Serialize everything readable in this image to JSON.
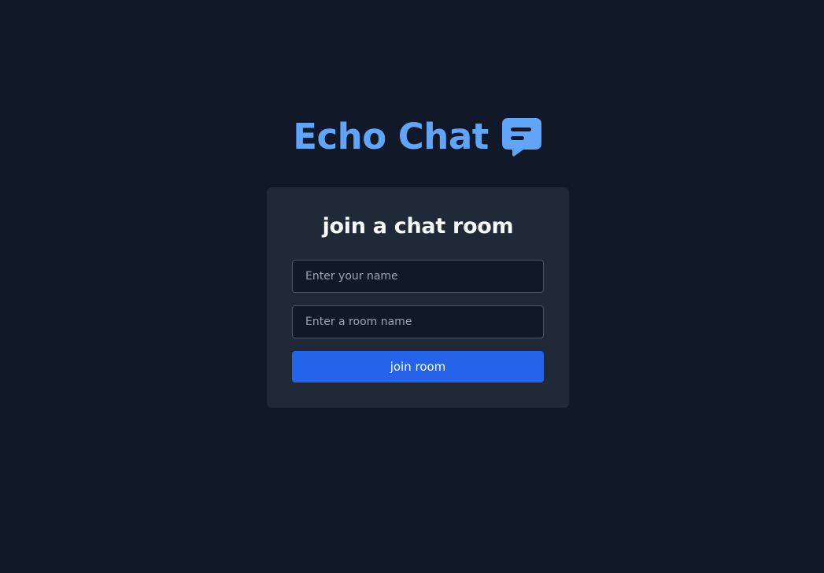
{
  "app": {
    "title": "Echo Chat",
    "logo_icon": "chat-bubble-icon",
    "accent_color": "#60a5fa"
  },
  "join_form": {
    "heading": "join a chat room",
    "name_field": {
      "value": "",
      "placeholder": "Enter your name"
    },
    "room_field": {
      "value": "",
      "placeholder": "Enter a room name"
    },
    "submit_label": "join room",
    "button_color": "#2563eb"
  },
  "colors": {
    "background": "#111827",
    "card": "#1f2937",
    "input_background": "#111827",
    "input_border": "#4b5563",
    "heading_text": "#f9fafb"
  }
}
